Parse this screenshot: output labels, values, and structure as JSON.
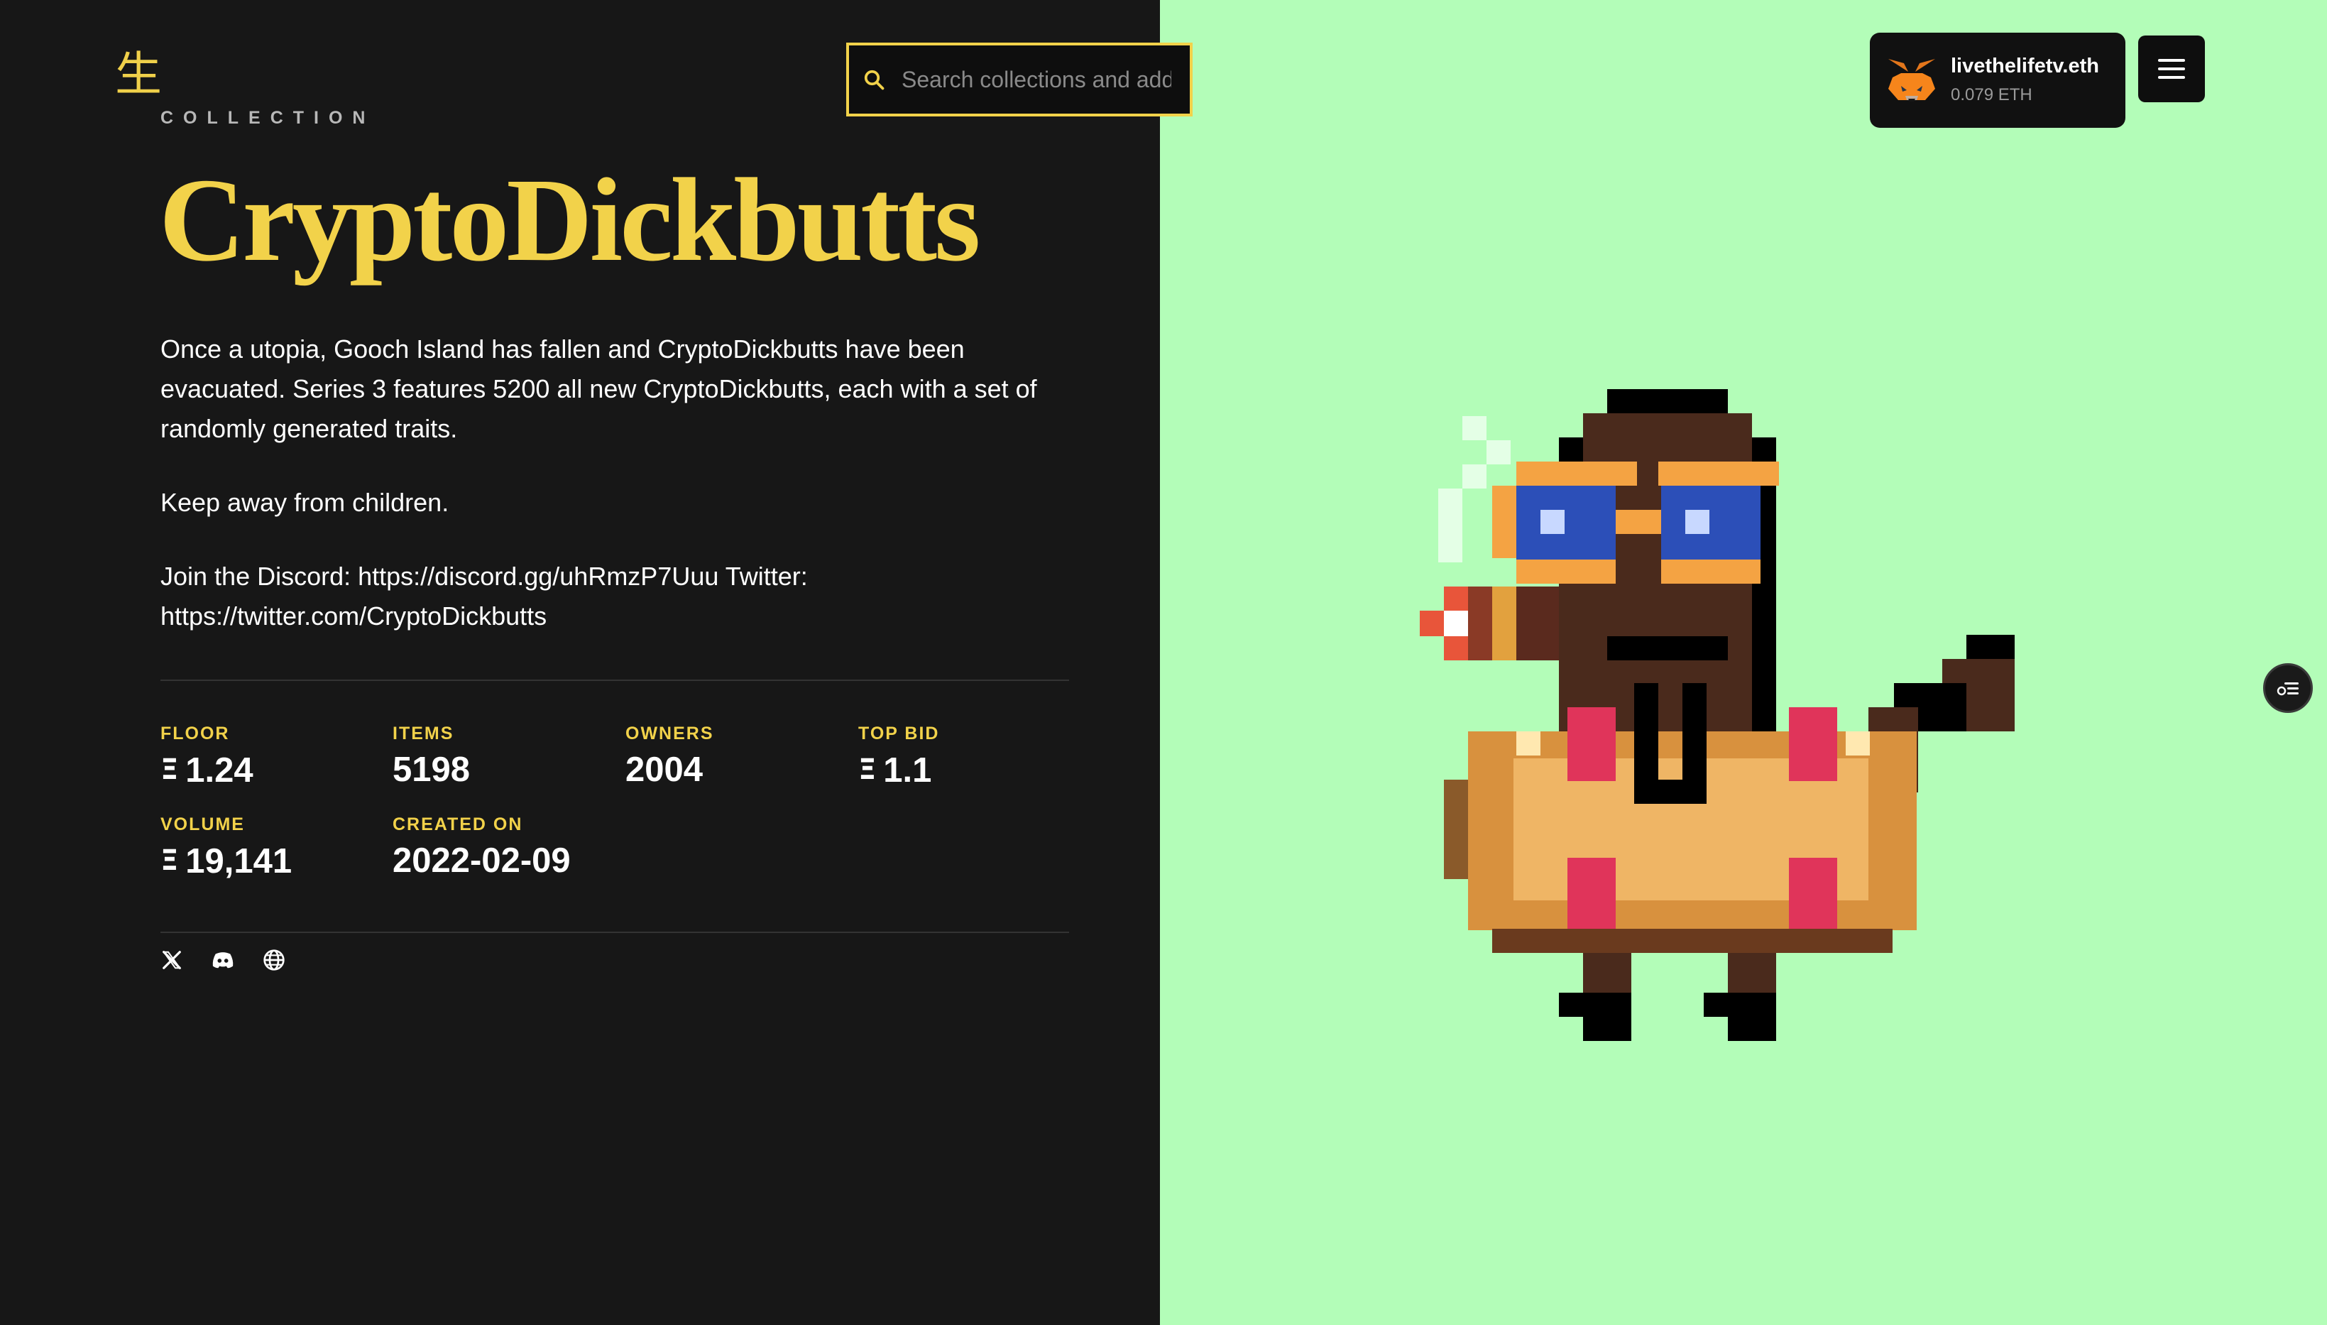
{
  "logo": {
    "glyph": "生"
  },
  "collection": {
    "eyebrow": "COLLECTION",
    "title": "CryptoDickbutts",
    "description": [
      "Once a utopia, Gooch Island has fallen and CryptoDickbutts have been evacuated. Series 3 features 5200 all new CryptoDickbutts, each with a set of randomly generated traits.",
      "Keep away from children.",
      "Join the Discord: https://discord.gg/uhRmzP7Uuu Twitter: https://twitter.com/CryptoDickbutts"
    ]
  },
  "stats": {
    "eth_symbol": "Ξ",
    "floor": {
      "label": "FLOOR",
      "value": "1.24"
    },
    "items": {
      "label": "ITEMS",
      "value": "5198"
    },
    "owners": {
      "label": "OWNERS",
      "value": "2004"
    },
    "top_bid": {
      "label": "TOP BID",
      "value": "1.1"
    },
    "volume": {
      "label": "VOLUME",
      "value": "19,141"
    },
    "created_on": {
      "label": "CREATED ON",
      "value": "2022-02-09"
    }
  },
  "socials": [
    "x-icon",
    "discord-icon",
    "globe-icon"
  ],
  "search": {
    "placeholder": "Search collections and add"
  },
  "wallet": {
    "name": "livethelifetv.eth",
    "balance": "0.079 ETH",
    "icon": "metamask-fox-icon"
  },
  "colors": {
    "accent": "#f2d24a",
    "left_bg": "#171717",
    "right_bg": "#b3fdb8"
  }
}
